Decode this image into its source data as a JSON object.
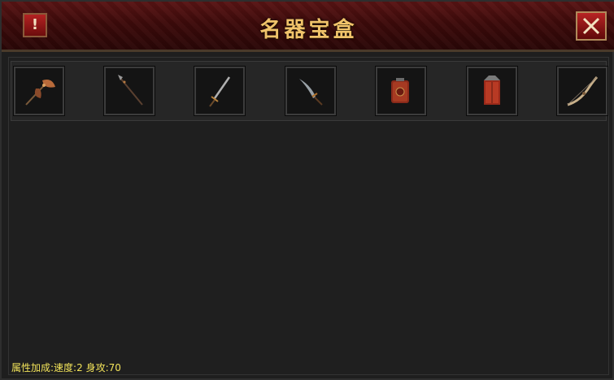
{
  "window": {
    "title": "名器宝盒",
    "alert_label": "!",
    "close_icon": "close-x-icon"
  },
  "slots": [
    {
      "name": "axe",
      "icon": "axe-icon"
    },
    {
      "name": "spear",
      "icon": "spear-icon"
    },
    {
      "name": "sword",
      "icon": "sword-icon"
    },
    {
      "name": "blade",
      "icon": "blade-icon"
    },
    {
      "name": "shield",
      "icon": "round-shield-icon"
    },
    {
      "name": "armor",
      "icon": "armor-icon"
    },
    {
      "name": "bow",
      "icon": "bow-icon"
    }
  ],
  "attributes": {
    "label": "属性加成:",
    "speed_label": "速度:",
    "speed_value": "2",
    "attack_label": "身攻:",
    "attack_value": "70"
  },
  "colors": {
    "title": "#f0c36a",
    "attr_text": "#f2e35a",
    "titlebar": "#4a0f0f"
  }
}
